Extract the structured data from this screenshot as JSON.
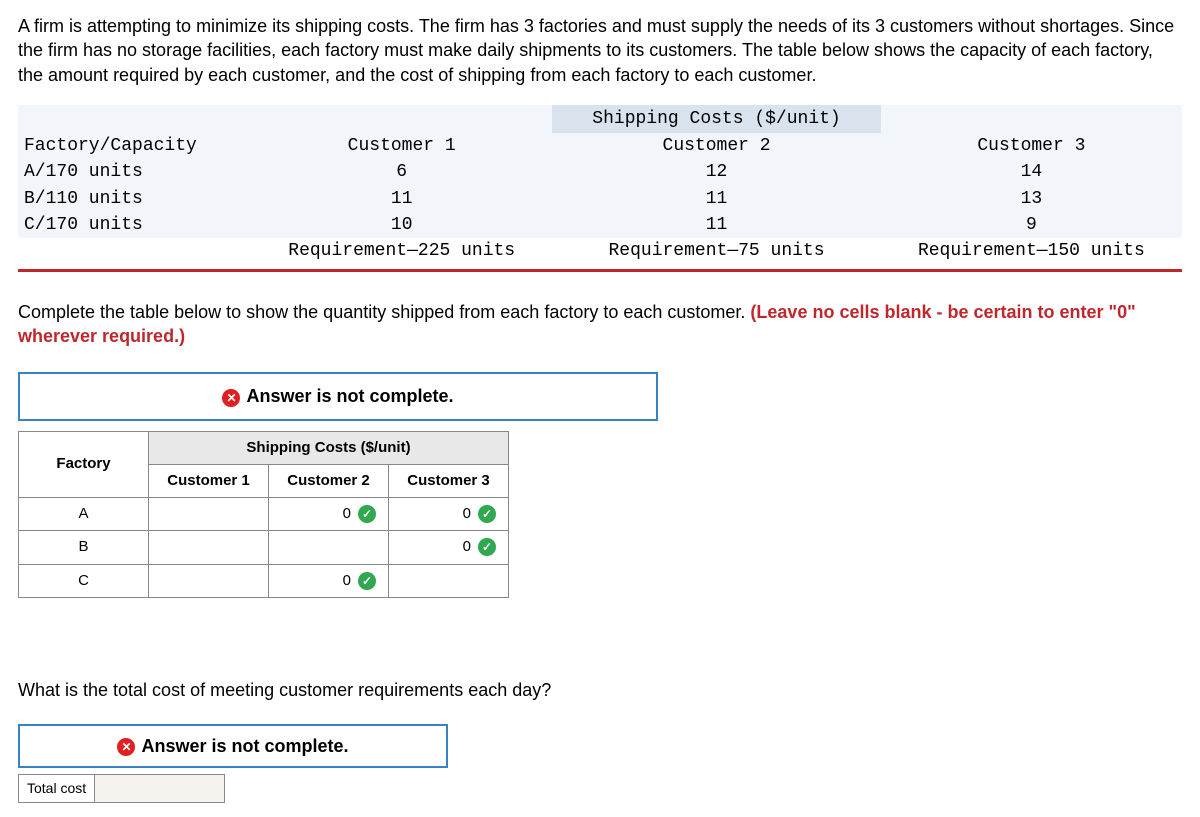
{
  "problem_text": "A firm is attempting to minimize its shipping costs. The firm has 3 factories and must supply the needs of its 3 customers without shortages. Since the firm has no storage facilities, each factory must make daily shipments to its customers. The table below shows the capacity of each factory, the amount required by each customer, and the cost of shipping from each factory to each customer.",
  "shipping_table": {
    "group_header": "Shipping Costs ($/unit)",
    "corner_label": "Factory/Capacity",
    "col_headers": [
      "Customer 1",
      "Customer 2",
      "Customer 3"
    ],
    "rows": [
      {
        "label": "A/170 units",
        "values": [
          "6",
          "12",
          "14"
        ]
      },
      {
        "label": "B/110 units",
        "values": [
          "11",
          "11",
          "13"
        ]
      },
      {
        "label": "C/170 units",
        "values": [
          "10",
          "11",
          "9"
        ]
      }
    ],
    "requirements": [
      "Requirement—225 units",
      "Requirement—75 units",
      "Requirement—150 units"
    ]
  },
  "instruction_prefix": "Complete the table below to show the quantity shipped from each factory to each customer. ",
  "instruction_red": "(Leave no cells blank - be certain to enter \"0\" wherever required.)",
  "banner_text": "Answer is not complete.",
  "answer_table": {
    "group_header": "Shipping Costs ($/unit)",
    "row_header": "Factory",
    "col_headers": [
      "Customer 1",
      "Customer 2",
      "Customer 3"
    ],
    "rows": [
      {
        "label": "A",
        "cells": [
          {
            "value": "",
            "check": false
          },
          {
            "value": "0",
            "check": true
          },
          {
            "value": "0",
            "check": true
          }
        ]
      },
      {
        "label": "B",
        "cells": [
          {
            "value": "",
            "check": false
          },
          {
            "value": "",
            "check": false
          },
          {
            "value": "0",
            "check": true
          }
        ]
      },
      {
        "label": "C",
        "cells": [
          {
            "value": "",
            "check": false
          },
          {
            "value": "0",
            "check": true
          },
          {
            "value": "",
            "check": false
          }
        ]
      }
    ]
  },
  "question2": "What is the total cost of meeting customer requirements each day?",
  "total_label": "Total cost",
  "total_value": ""
}
